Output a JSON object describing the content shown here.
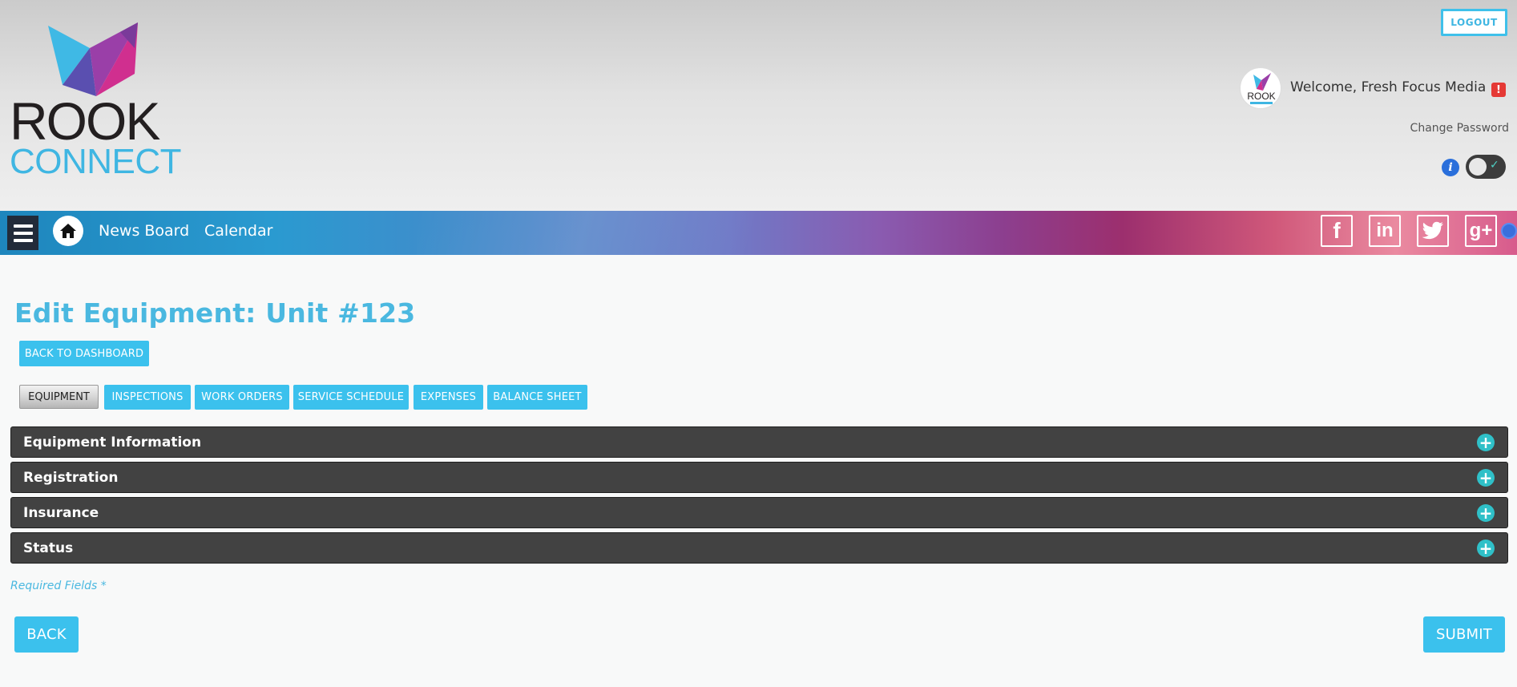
{
  "header": {
    "logo": {
      "word1": "ROOK",
      "word2": "CONNECT"
    },
    "logout_label": "LOGOUT",
    "welcome_text": "Welcome, Fresh Focus Media",
    "alert_glyph": "!",
    "change_password": "Change Password",
    "info_glyph": "i",
    "avatar_text": "ROOK"
  },
  "navbar": {
    "links": [
      "News Board",
      "Calendar"
    ],
    "social": [
      {
        "icon": "facebook-icon",
        "glyph": "f"
      },
      {
        "icon": "linkedin-icon",
        "glyph": "in"
      },
      {
        "icon": "twitter-icon",
        "glyph": "t"
      },
      {
        "icon": "google-plus-icon",
        "glyph": "g+"
      }
    ]
  },
  "main": {
    "title": "Edit Equipment: Unit #123",
    "back_to_dashboard": "BACK TO DASHBOARD",
    "tabs": [
      {
        "label": "EQUIPMENT",
        "active": true
      },
      {
        "label": "INSPECTIONS",
        "active": false
      },
      {
        "label": "WORK ORDERS",
        "active": false
      },
      {
        "label": "SERVICE SCHEDULE",
        "active": false
      },
      {
        "label": "EXPENSES",
        "active": false
      },
      {
        "label": "BALANCE SHEET",
        "active": false
      }
    ],
    "sections": [
      "Equipment Information",
      "Registration",
      "Insurance",
      "Status"
    ],
    "required_note": "Required Fields *",
    "back_label": "BACK",
    "submit_label": "SUBMIT"
  },
  "colors": {
    "accent": "#3bc1ed",
    "title": "#4ab8e0",
    "accordion_bg": "#424242",
    "plus_icon": "#2fc0c8",
    "alert": "#e53935"
  }
}
